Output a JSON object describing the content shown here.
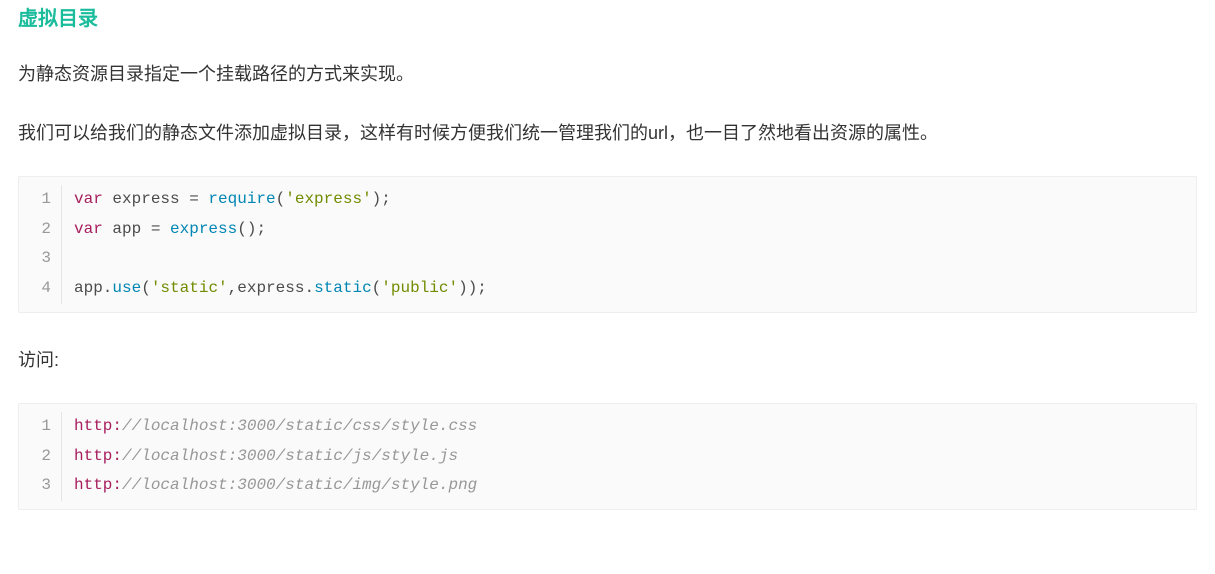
{
  "heading": "虚拟目录",
  "para1": "为静态资源目录指定一个挂载路径的方式来实现。",
  "para2": "我们可以给我们的静态文件添加虚拟目录，这样有时候方便我们统一管理我们的url，也一目了然地看出资源的属性。",
  "code1": {
    "lines": [
      {
        "n": "1",
        "tokens": [
          {
            "t": "var ",
            "c": "tok-kw"
          },
          {
            "t": "express = ",
            "c": ""
          },
          {
            "t": "require",
            "c": "tok-fn"
          },
          {
            "t": "(",
            "c": ""
          },
          {
            "t": "'express'",
            "c": "tok-str"
          },
          {
            "t": ");",
            "c": ""
          }
        ]
      },
      {
        "n": "2",
        "tokens": [
          {
            "t": "var ",
            "c": "tok-kw"
          },
          {
            "t": "app = ",
            "c": ""
          },
          {
            "t": "express",
            "c": "tok-fn"
          },
          {
            "t": "();",
            "c": ""
          }
        ]
      },
      {
        "n": "3",
        "tokens": []
      },
      {
        "n": "4",
        "tokens": [
          {
            "t": "app.",
            "c": ""
          },
          {
            "t": "use",
            "c": "tok-fn"
          },
          {
            "t": "(",
            "c": ""
          },
          {
            "t": "'static'",
            "c": "tok-str"
          },
          {
            "t": ",express.",
            "c": ""
          },
          {
            "t": "static",
            "c": "tok-fn"
          },
          {
            "t": "(",
            "c": ""
          },
          {
            "t": "'public'",
            "c": "tok-str"
          },
          {
            "t": "));",
            "c": ""
          }
        ]
      }
    ]
  },
  "para3": "访问:",
  "code2": {
    "lines": [
      {
        "n": "1",
        "tokens": [
          {
            "t": "http:",
            "c": "tok-kw"
          },
          {
            "t": "//localhost:3000/static/css/style.css",
            "c": "tok-cmt"
          }
        ]
      },
      {
        "n": "2",
        "tokens": [
          {
            "t": "http:",
            "c": "tok-kw"
          },
          {
            "t": "//localhost:3000/static/js/style.js",
            "c": "tok-cmt"
          }
        ]
      },
      {
        "n": "3",
        "tokens": [
          {
            "t": "http:",
            "c": "tok-kw"
          },
          {
            "t": "//localhost:3000/static/img/style.png",
            "c": "tok-cmt"
          }
        ]
      }
    ]
  }
}
